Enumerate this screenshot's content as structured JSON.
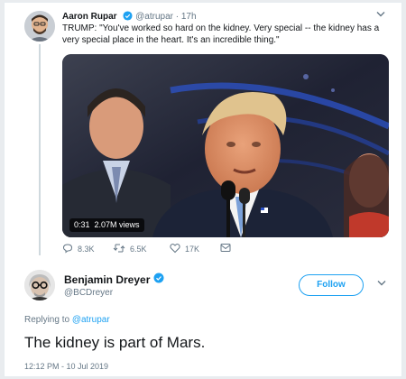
{
  "parent_tweet": {
    "author_name": "Aaron Rupar",
    "verified_icon": "verified-badge-icon",
    "handle": "@atrupar",
    "separator": "·",
    "time": "17h",
    "text": "TRUMP: \"You've worked so hard on the kidney. Very special -- the kidney has a very special place in the heart. It's an incredible thing.\"",
    "video": {
      "duration": "0:31",
      "views": "2.07M views"
    },
    "actions": {
      "reply_count": "8.3K",
      "retweet_count": "6.5K",
      "like_count": "17K"
    }
  },
  "reply_tweet": {
    "author_name": "Benjamin Dreyer",
    "handle": "@BCDreyer",
    "follow_label": "Follow",
    "replying_prefix": "Replying to",
    "replying_to": "@atrupar",
    "text": "The kidney is part of Mars.",
    "timestamp": "12:12 PM - 10 Jul 2019"
  },
  "colors": {
    "accent": "#1da1f2",
    "secondary_text": "#657786",
    "primary_text": "#14171a"
  }
}
